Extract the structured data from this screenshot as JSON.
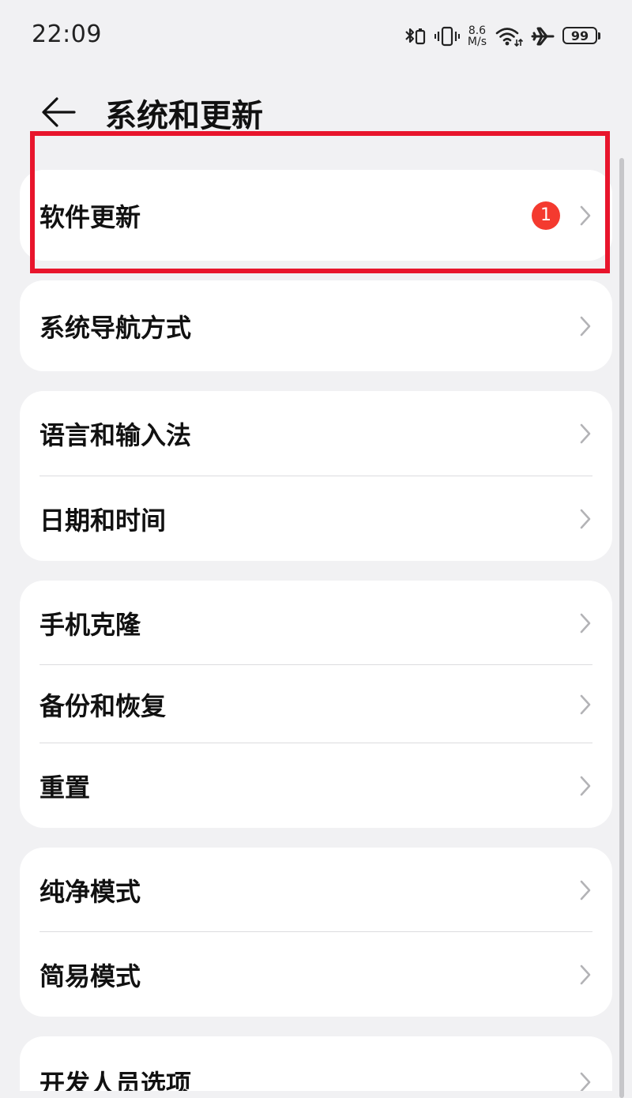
{
  "status_bar": {
    "time": "22:09",
    "net_speed_value": "8.6",
    "net_speed_unit": "M/s",
    "battery": "99",
    "icons": [
      "bluetooth-icon",
      "vibrate-icon",
      "wifi-icon",
      "airplane-icon",
      "battery-icon"
    ]
  },
  "header": {
    "title": "系统和更新"
  },
  "groups": [
    {
      "items": [
        {
          "label": "软件更新",
          "badge": "1"
        }
      ]
    },
    {
      "items": [
        {
          "label": "系统导航方式"
        }
      ]
    },
    {
      "items": [
        {
          "label": "语言和输入法"
        },
        {
          "label": "日期和时间"
        }
      ]
    },
    {
      "items": [
        {
          "label": "手机克隆"
        },
        {
          "label": "备份和恢复"
        },
        {
          "label": "重置"
        }
      ]
    },
    {
      "items": [
        {
          "label": "纯净模式"
        },
        {
          "label": "简易模式"
        }
      ]
    },
    {
      "items": [
        {
          "label": "开发人员选项"
        }
      ]
    }
  ],
  "colors": {
    "background": "#f1f1f3",
    "card": "#ffffff",
    "badge": "#f43a2f",
    "highlight": "#e8152c"
  }
}
